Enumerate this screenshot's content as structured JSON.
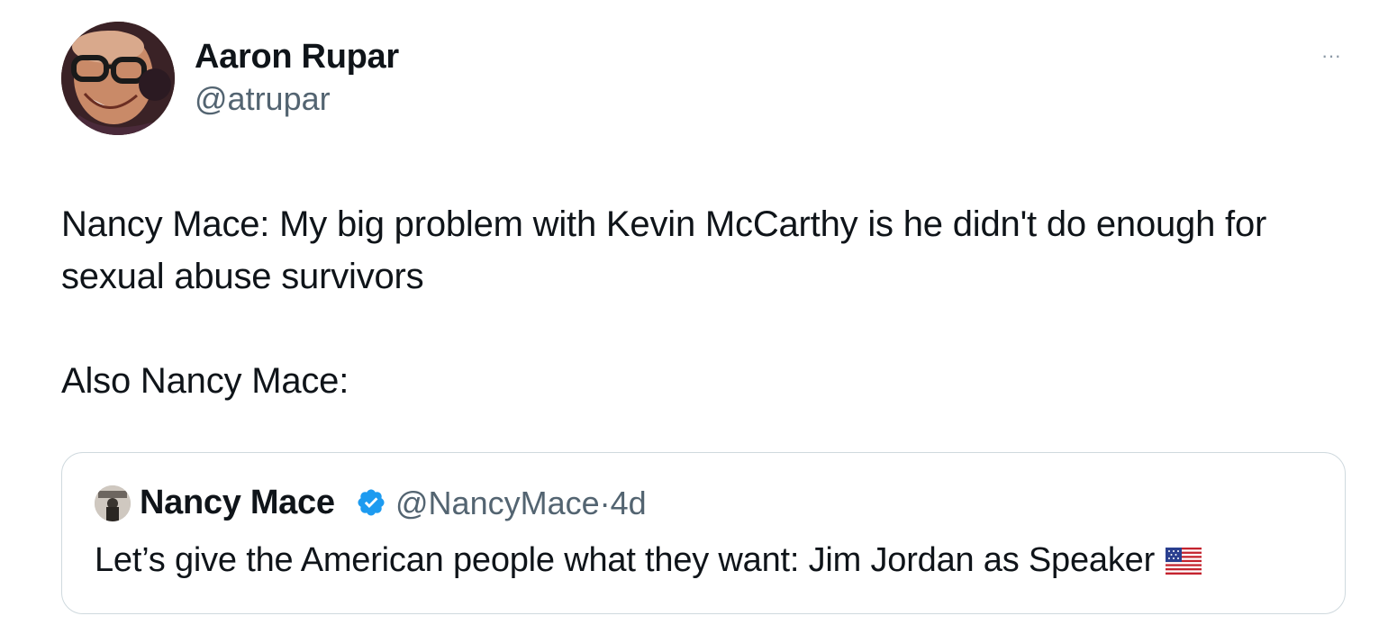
{
  "author": {
    "display_name": "Aaron Rupar",
    "handle": "@atrupar",
    "avatar_icon": "avatar-photo"
  },
  "more_icon": "more-icon",
  "more_label": "···",
  "tweet": {
    "line1": "Nancy Mace: My big problem with Kevin McCarthy is he didn't do enough for sexual abuse survivors",
    "line2": "Also Nancy Mace:"
  },
  "quoted": {
    "display_name": "Nancy Mace",
    "verified_icon": "verified-badge-icon",
    "handle": "@NancyMace",
    "separator": "·",
    "time": "4d",
    "text": "Let’s give the American people what they want: Jim Jordan as Speaker",
    "emoji_icon": "us-flag-icon"
  },
  "colors": {
    "text": "#0f1419",
    "secondary": "#536471",
    "border": "#cfd9de",
    "verified": "#1d9bf0"
  }
}
